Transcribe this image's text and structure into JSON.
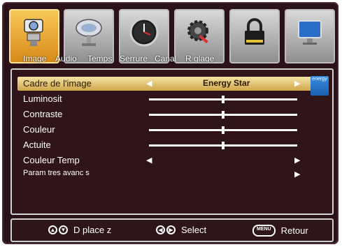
{
  "tabs": [
    {
      "label": "Image",
      "icon": "camera-icon",
      "active": true
    },
    {
      "label": "Audio",
      "icon": "satellite-dish-icon",
      "active": false
    },
    {
      "label": "Temps",
      "icon": "clock-icon",
      "active": false
    },
    {
      "label": "Serrure",
      "icon": "lock-icon",
      "active": false
    },
    {
      "label": "Canal",
      "icon": "gear-icon",
      "active": false
    },
    {
      "label": "R glage",
      "icon": "monitor-icon",
      "active": false
    }
  ],
  "menu": {
    "rows": [
      {
        "label": "Cadre de l'image",
        "value": "Energy Star",
        "selected": true
      },
      {
        "label": "Luminosit",
        "level": 0.5
      },
      {
        "label": "Contraste",
        "level": 0.5
      },
      {
        "label": "Couleur",
        "level": 0.5
      },
      {
        "label": "Actuite",
        "level": 0.5
      },
      {
        "label": "Couleur Temp"
      },
      {
        "label": "Param tres avanc s"
      }
    ],
    "energy_badge_text": "energy"
  },
  "footer": {
    "move_label": "D place z",
    "select_label": "Select",
    "menu_key": "MENU",
    "back_label": "Retour"
  },
  "colors": {
    "background": "#2a1318",
    "accent": "#f3c357",
    "selected_row": "#e8c878"
  }
}
